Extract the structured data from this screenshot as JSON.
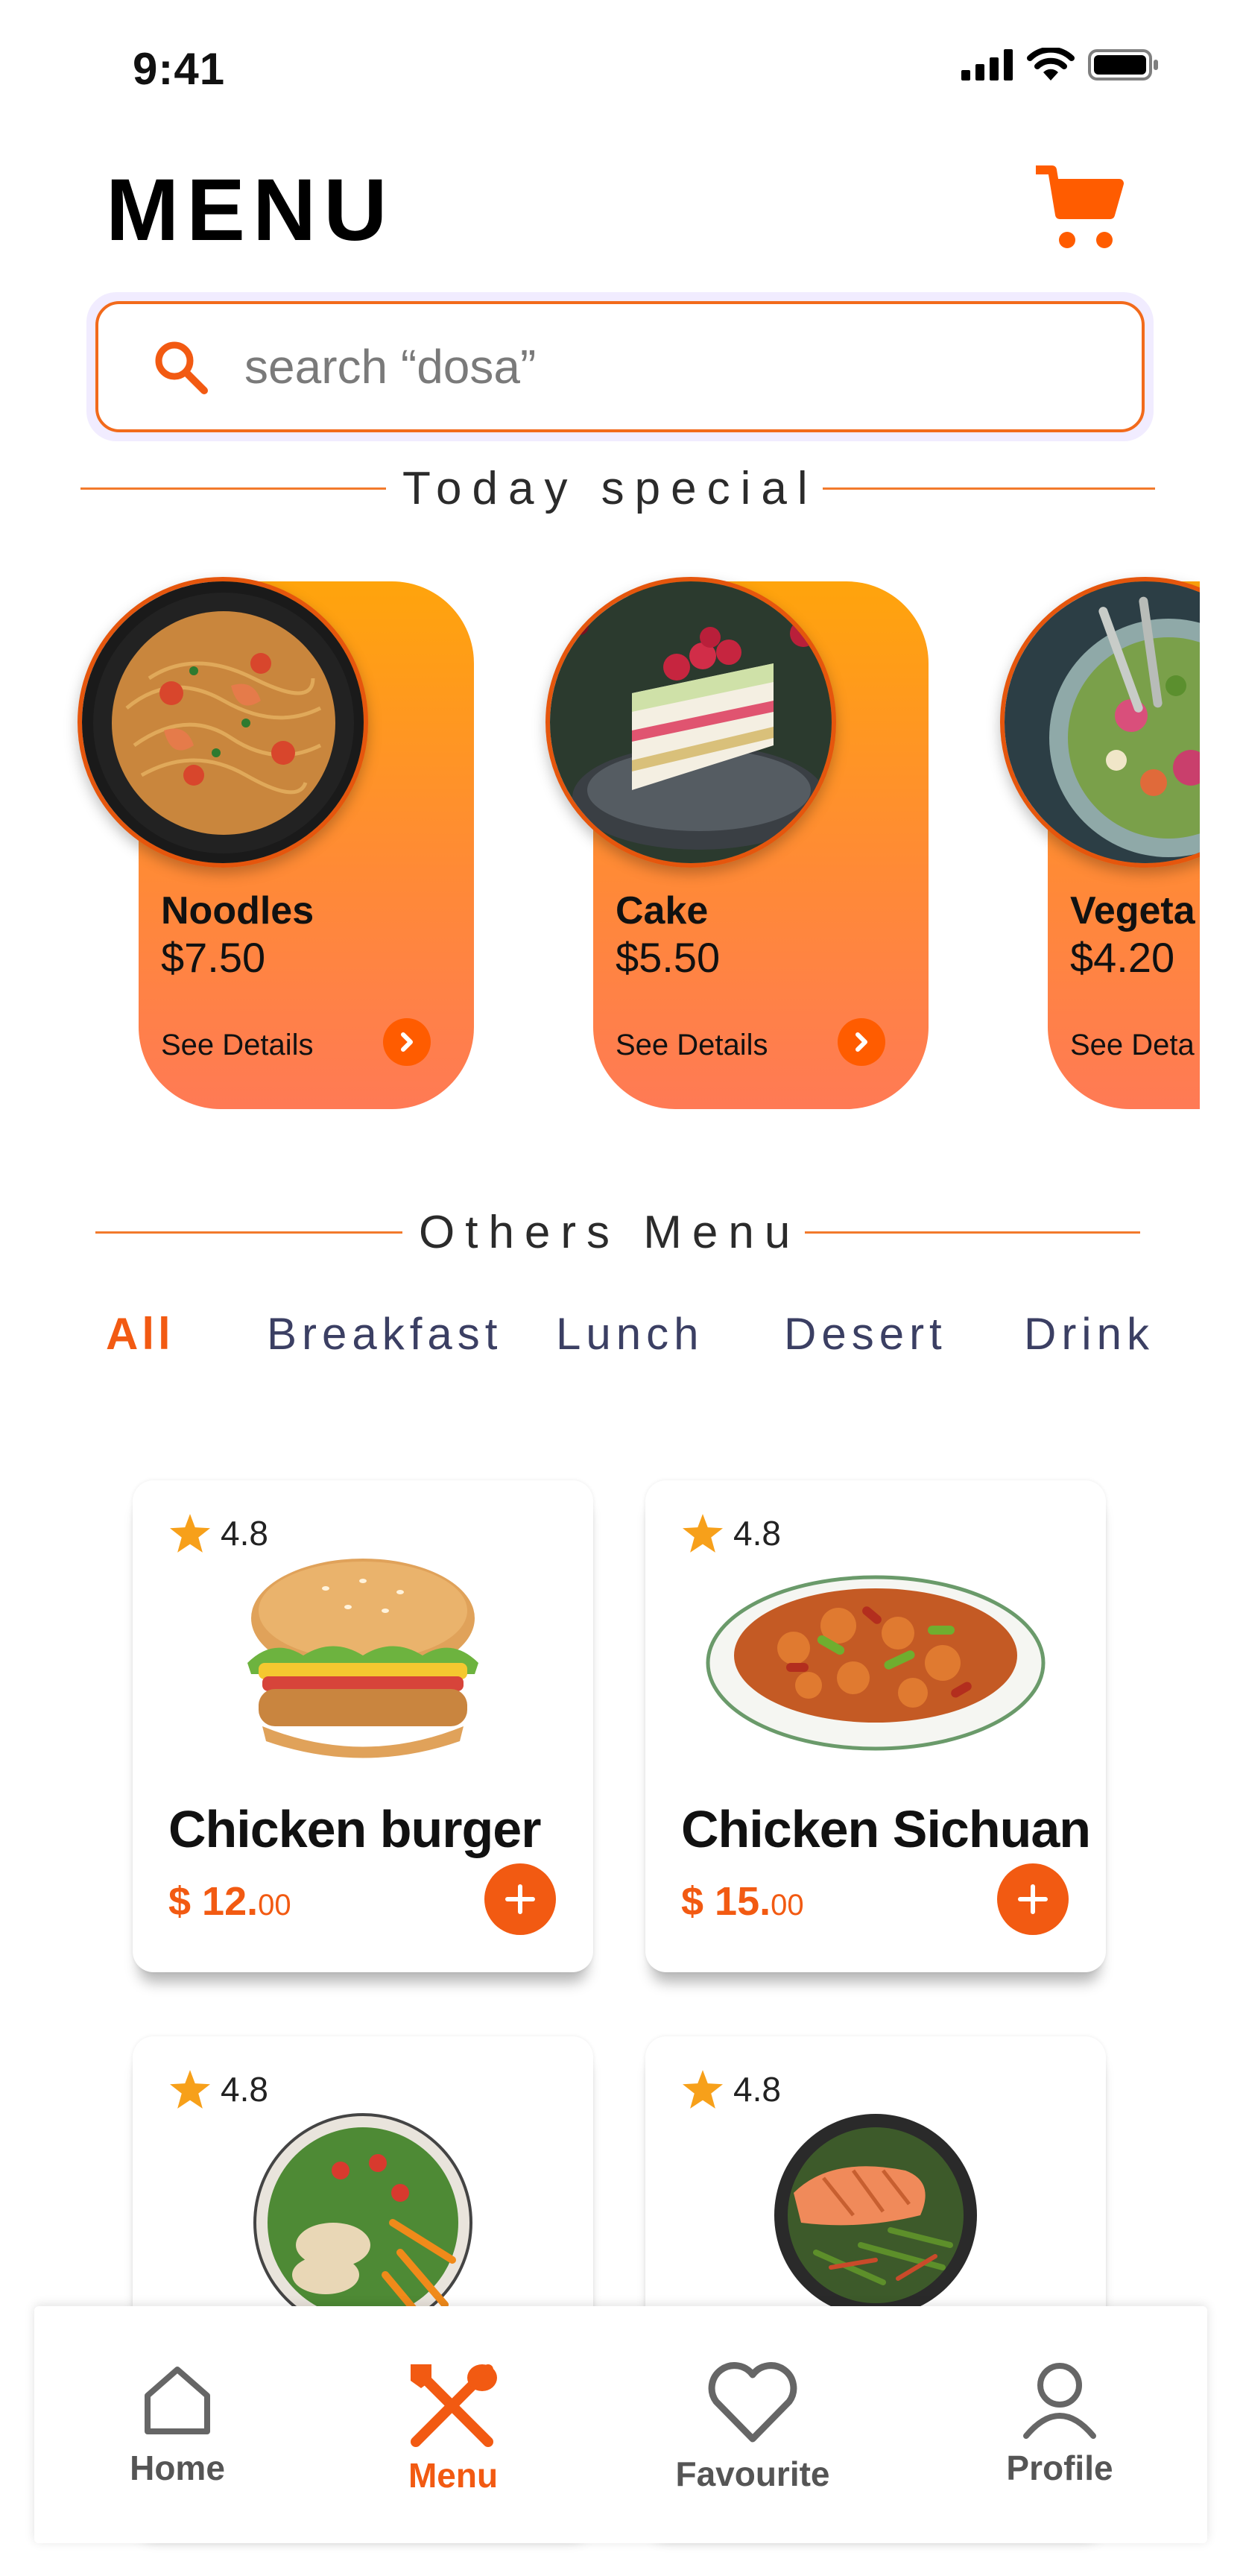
{
  "status_bar": {
    "time": "9:41"
  },
  "header": {
    "title": "MENU"
  },
  "search": {
    "placeholder": "search “dosa”"
  },
  "sections": {
    "today_special": "Today special",
    "others_menu": "Others Menu"
  },
  "specials": [
    {
      "name": "Noodles",
      "price": "$7.50",
      "details": "See Details"
    },
    {
      "name": "Cake",
      "price": "$5.50",
      "details": "See Details"
    },
    {
      "name": "Vegeta",
      "price": "$4.20",
      "details": "See Deta"
    }
  ],
  "categories": [
    {
      "label": "All",
      "active": true
    },
    {
      "label": "Breakfast",
      "active": false
    },
    {
      "label": "Lunch",
      "active": false
    },
    {
      "label": "Desert",
      "active": false
    },
    {
      "label": "Drink",
      "active": false
    }
  ],
  "foods": [
    {
      "rating": "4.8",
      "name": "Chicken burger",
      "price_main": "$ 12.",
      "price_cents": "00"
    },
    {
      "rating": "4.8",
      "name": "Chicken Sichuan",
      "price_main": "$ 15.",
      "price_cents": "00"
    },
    {
      "rating": "4.8",
      "name": "",
      "price_main": "",
      "price_cents": ""
    },
    {
      "rating": "4.8",
      "name": "",
      "price_main": "",
      "price_cents": ""
    }
  ],
  "nav": [
    {
      "label": "Home",
      "icon": "home-icon",
      "active": false
    },
    {
      "label": "Menu",
      "icon": "fork-spoon-icon",
      "active": true
    },
    {
      "label": "Favourite",
      "icon": "heart-icon",
      "active": false
    },
    {
      "label": "Profile",
      "icon": "profile-icon",
      "active": false
    }
  ],
  "colors": {
    "accent": "#f25a12",
    "card_gradient_top": "#ffa40c",
    "card_gradient_bottom": "#ff7a55",
    "star": "#f7a01a"
  }
}
